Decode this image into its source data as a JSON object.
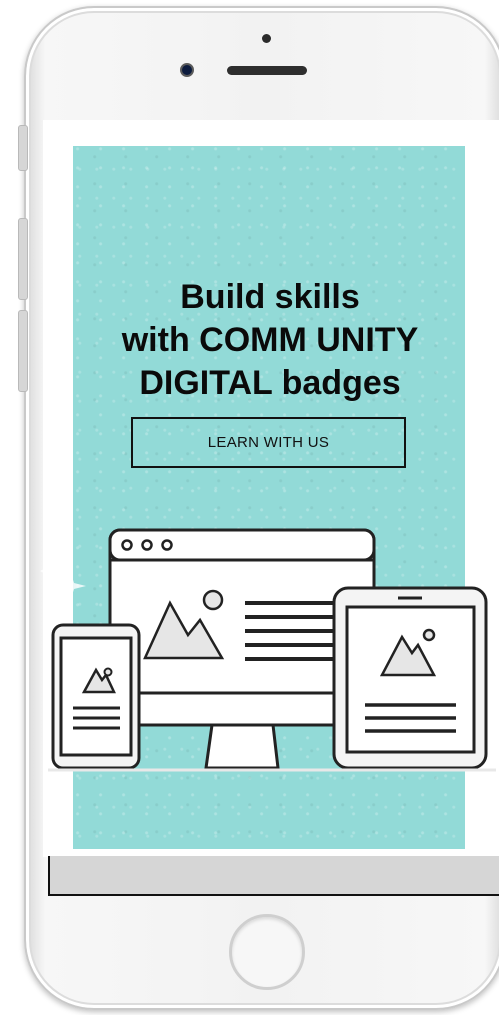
{
  "device": {
    "hardware_icons": [
      "front-camera-icon",
      "speaker-icon",
      "home-button-icon"
    ]
  },
  "hero": {
    "headline_lines": [
      "Build skills",
      "with COMM UNITY",
      "DIGITAL badges"
    ],
    "cta_label": "LEARN WITH US",
    "background_color": "#92dad7",
    "illustration_icons": [
      "desktop-monitor-icon",
      "tablet-icon",
      "smartphone-icon",
      "image-placeholder-icon",
      "sparkle-icon"
    ]
  },
  "colors": {
    "accent": "#92dad7",
    "text": "#0a0a0a",
    "frame": "#f2f2f2"
  }
}
